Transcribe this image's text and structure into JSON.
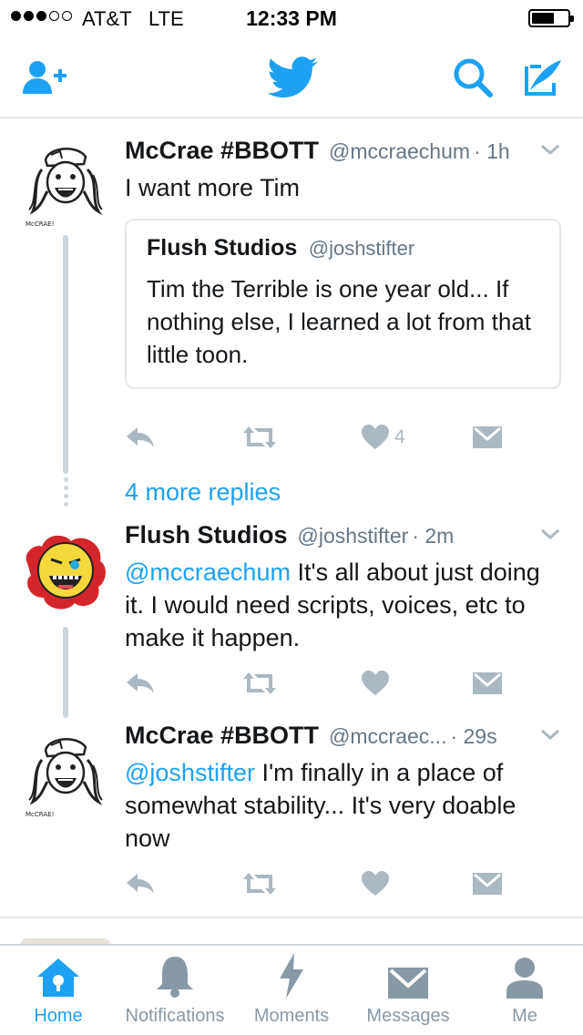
{
  "status_bar": {
    "carrier": "AT&T",
    "network": "LTE",
    "time": "12:33 PM",
    "signal_bars_filled": 3,
    "signal_bars_total": 5,
    "battery_level": 0.55
  },
  "nav": {
    "add_user_icon": "add-user-icon",
    "logo_icon": "twitter-bird-icon",
    "search_icon": "search-icon",
    "compose_icon": "compose-icon",
    "accent_color": "#1da1f2"
  },
  "tweets": [
    {
      "name": "McCrae #BBOTT",
      "handle": "@mccraechum",
      "time": "· 1h",
      "text": "I want more Tim",
      "quote": {
        "name": "Flush Studios",
        "handle": "@joshstifter",
        "text": "Tim the Terrible is one year old... If nothing else, I learned a lot from that little toon."
      },
      "like_count": "4",
      "avatar_caption": "McCRAE!"
    },
    {
      "name": "Flush Studios",
      "handle": "@joshstifter",
      "time": "· 2m",
      "mention": "@mccraechum",
      "text": " It's all about just doing it. I would need scripts, voices, etc to make it happen."
    },
    {
      "name": "McCrae #BBOTT",
      "handle": "@mccraec...",
      "time": "· 29s",
      "mention": "@joshstifter",
      "text": " I'm finally in a place of somewhat stability... It's very doable now",
      "avatar_caption": "McCRAE!"
    }
  ],
  "more_replies": "4 more replies",
  "tabs": [
    {
      "label": "Home",
      "icon": "home-icon",
      "active": true
    },
    {
      "label": "Notifications",
      "icon": "bell-icon",
      "active": false
    },
    {
      "label": "Moments",
      "icon": "lightning-icon",
      "active": false
    },
    {
      "label": "Messages",
      "icon": "envelope-icon",
      "active": false
    },
    {
      "label": "Me",
      "icon": "person-icon",
      "active": false
    }
  ]
}
